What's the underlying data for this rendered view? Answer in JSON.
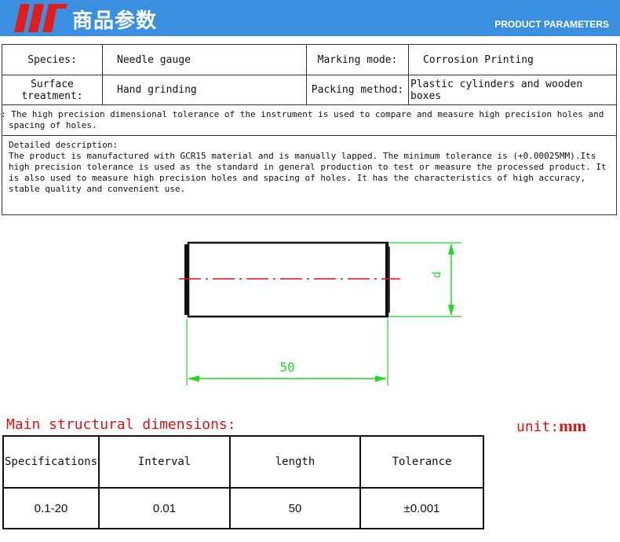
{
  "header": {
    "title_cn": "商品参数",
    "title_en": "PRODUCT PARAMETERS",
    "brand_color": "#3b8fe0",
    "logo_color": "#e21b1b"
  },
  "params": {
    "species_label": "Species:",
    "species_value": "Needle gauge",
    "marking_label": "Marking mode:",
    "marking_value": "Corrosion Printing",
    "surface_label_1": "Surface",
    "surface_label_2": "treatment:",
    "surface_value": "Hand grinding",
    "packing_label": "Packing method:",
    "packing_value": "Plastic cylinders and wooden boxes"
  },
  "usage": "Usage: The high precision dimensional tolerance of the instrument is used to compare and measure high precision holes and spacing of holes.",
  "description": {
    "heading": "Detailed description:",
    "body": "The product is manufactured with GCR15 material and is manually lapped. The minimum tolerance is (+0.00025MM).Its high precision tolerance is used as the standard in general production to test or measure the processed product. It is also used to measure high precision holes and spacing of holes. It has the characteristics of high accuracy, stable quality and convenient use."
  },
  "drawing": {
    "length_label": "50",
    "diameter_label": "d",
    "dimension_color": "#1fd81f",
    "centerline_color": "#e01010"
  },
  "dimensions": {
    "title": "Main structural dimensions:",
    "unit_prefix": "unit:",
    "unit_value": "mm",
    "headers": [
      "Specifications",
      "Interval",
      "length",
      "Tolerance"
    ],
    "row": [
      "0.1-20",
      "0.01",
      "50",
      "±0.001"
    ]
  }
}
